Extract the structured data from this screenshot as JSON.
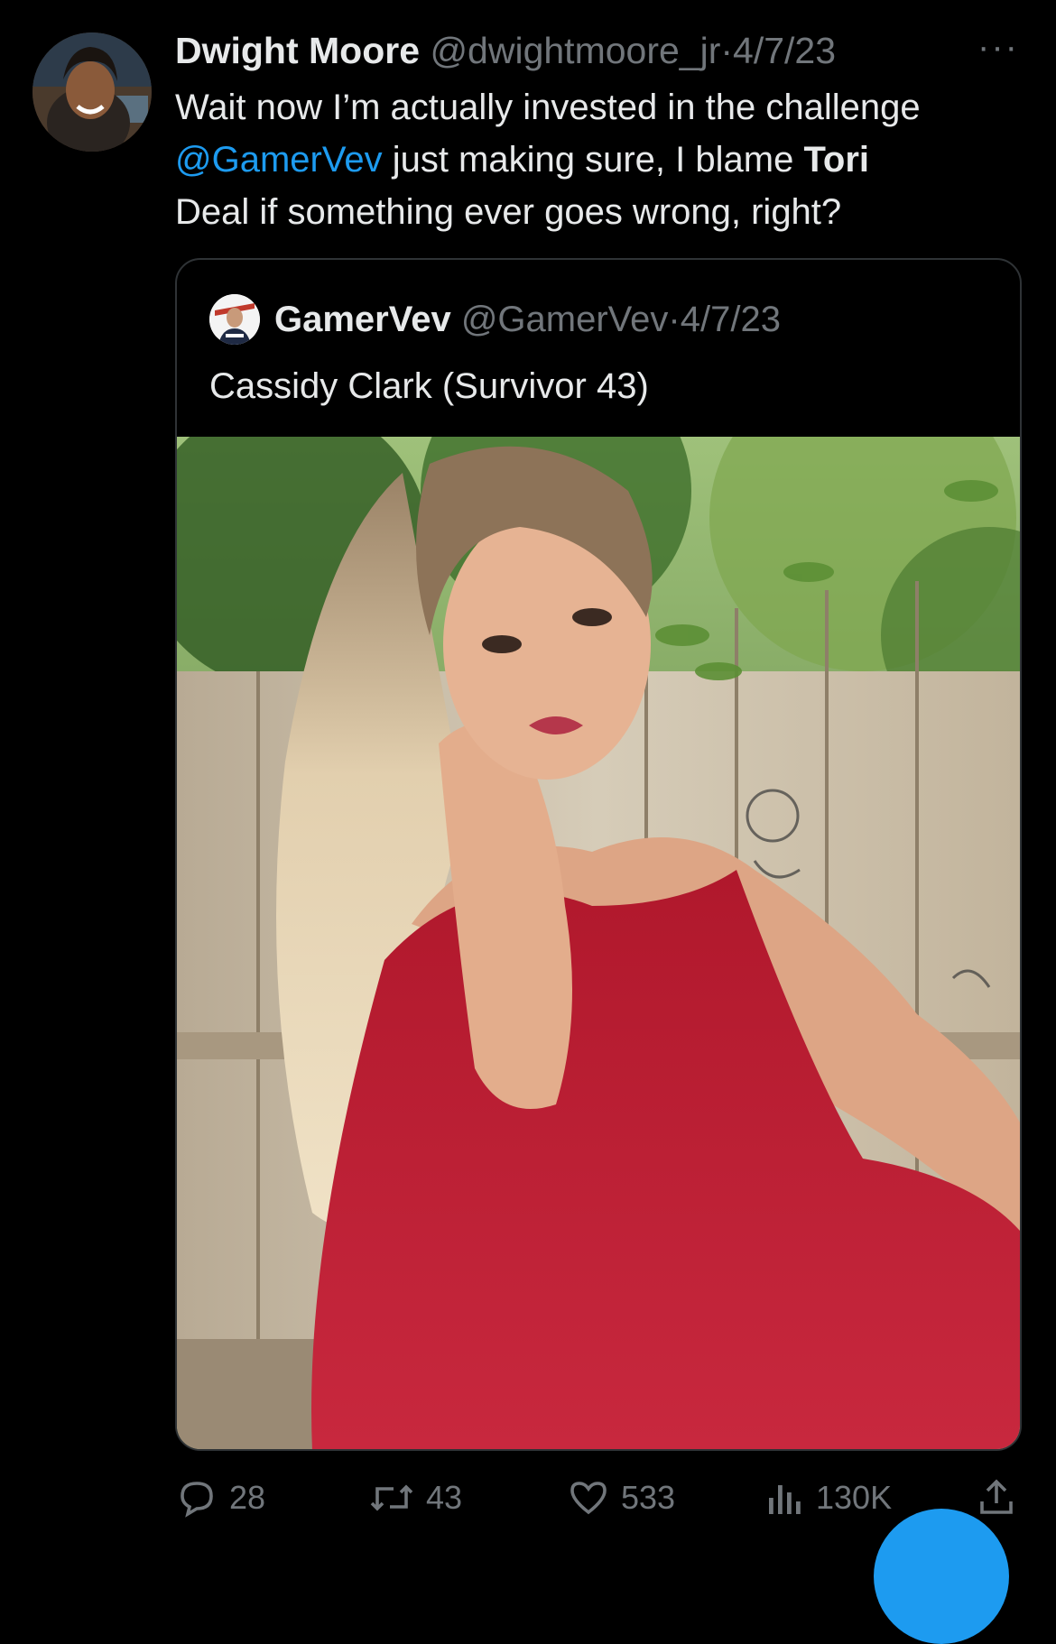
{
  "tweet": {
    "author_name": "Dwight Moore",
    "handle": "@dwightmoore_jr",
    "separator": "·",
    "date": "4/7/23",
    "more": "···",
    "text_line1": "Wait now I’m actually invested in the challenge",
    "mention": "@GamerVev",
    "text_mid": " just making sure, I blame ",
    "bold_word": "Tori",
    "text_line3": "Deal if something ever goes wrong, right?"
  },
  "quote": {
    "author_name": "GamerVev",
    "handle": "@GamerVev",
    "separator": "·",
    "date": "4/7/23",
    "text": "Cassidy Clark (Survivor 43)"
  },
  "actions": {
    "replies": "28",
    "retweets": "43",
    "likes": "533",
    "views": "130K"
  },
  "colors": {
    "background": "#000000",
    "text": "#e7e9ea",
    "muted": "#71767b",
    "accent": "#1d9bf0",
    "border": "#2f3336"
  },
  "icons": [
    "more-icon",
    "reply-icon",
    "retweet-icon",
    "like-icon",
    "views-icon",
    "share-icon"
  ]
}
